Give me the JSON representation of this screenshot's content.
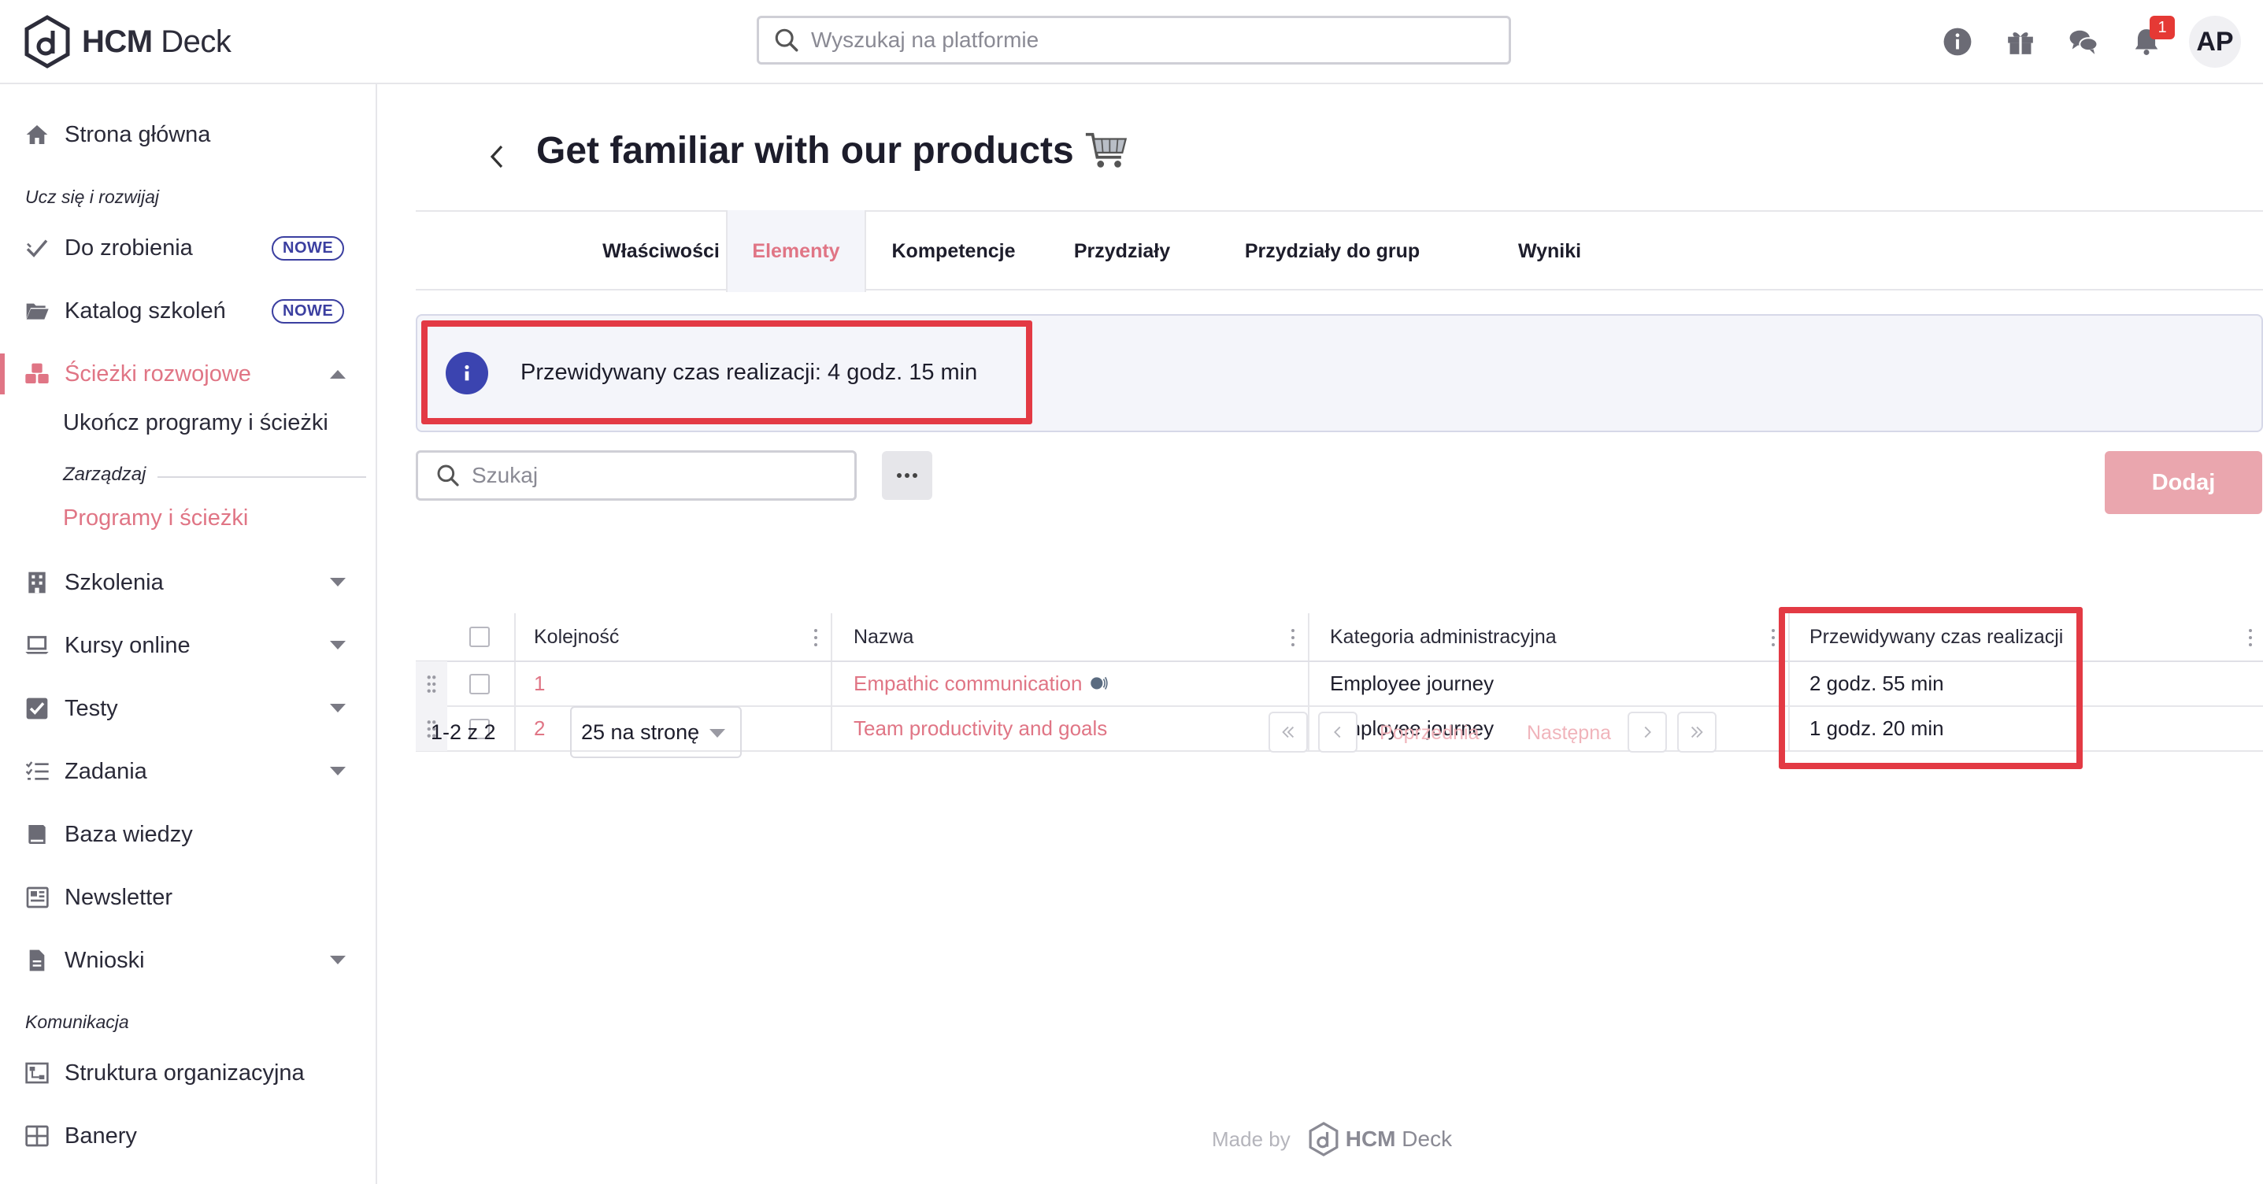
{
  "brand": {
    "name_bold": "HCM",
    "name_rest": " Deck"
  },
  "search_top": {
    "placeholder": "Wyszukaj na platformie"
  },
  "header": {
    "notifications_count": "1",
    "avatar_initials": "AP"
  },
  "sidebar": {
    "home": "Strona główna",
    "section_learn": "Ucz się i rozwijaj",
    "todo": "Do zrobienia",
    "catalog": "Katalog szkoleń",
    "new_badge": "NOWE",
    "paths": "Ścieżki rozwojowe",
    "paths_sub_complete": "Ukończ programy i ścieżki",
    "paths_sub_manage": "Zarządzaj",
    "paths_sub_programs": "Programy i ścieżki",
    "trainings": "Szkolenia",
    "courses": "Kursy online",
    "tests": "Testy",
    "tasks": "Zadania",
    "knowledge": "Baza wiedzy",
    "newsletter": "Newsletter",
    "requests": "Wnioski",
    "section_comm": "Komunikacja",
    "org": "Struktura organizacyjna",
    "banners": "Banery"
  },
  "page": {
    "title": "Get familiar with our products"
  },
  "tabs": [
    {
      "label": "Właściwości"
    },
    {
      "label": "Elementy"
    },
    {
      "label": "Kompetencje"
    },
    {
      "label": "Przydziały"
    },
    {
      "label": "Przydziały do grup"
    },
    {
      "label": "Wyniki"
    }
  ],
  "info": {
    "text": "Przewidywany czas realizacji: 4 godz. 15 min"
  },
  "toolbar": {
    "search_placeholder": "Szukaj",
    "add_label": "Dodaj"
  },
  "table": {
    "headers": {
      "order": "Kolejność",
      "name": "Nazwa",
      "category": "Kategoria administracyjna",
      "time": "Przewidywany czas realizacji"
    },
    "rows": [
      {
        "order": "1",
        "name": "Empathic communication",
        "category": "Employee journey",
        "time": "2 godz. 55 min"
      },
      {
        "order": "2",
        "name": "Team productivity and goals",
        "category": "Employee journey",
        "time": "1 godz. 20 min"
      }
    ]
  },
  "pagination": {
    "range": "1-2 z 2",
    "per_page": "25 na stronę",
    "prev": "Poprzednia",
    "next": "Następna"
  },
  "footer": {
    "made_by": "Made by",
    "brand_bold": "HCM",
    "brand_rest": " Deck"
  },
  "colors": {
    "accent": "#e07585",
    "primary": "#3b44b0",
    "highlight": "#e33a44",
    "button_disabled": "#eaa6ae"
  },
  "icons": [
    "hcm-deck-logo",
    "search-icon",
    "info-icon",
    "gift-icon",
    "chat-icon",
    "bell-icon",
    "home-icon",
    "check-icon",
    "folder-icon",
    "paths-icon",
    "building-icon",
    "laptop-icon",
    "checkbox-icon",
    "list-icon",
    "book-icon",
    "newspaper-icon",
    "document-icon",
    "org-chart-icon",
    "banner-icon",
    "cart-icon",
    "drag-handle-icon"
  ]
}
